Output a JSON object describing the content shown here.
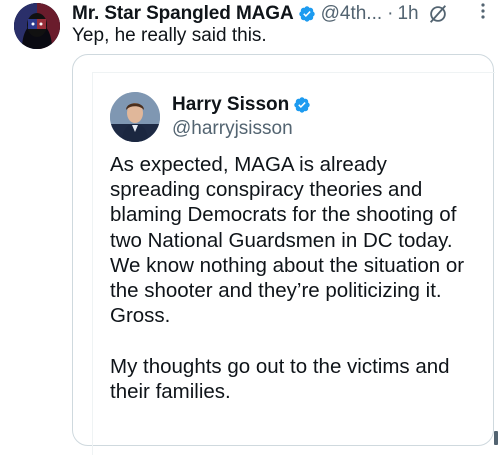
{
  "post": {
    "author_name": "Mr. Star Spangled MAGA",
    "author_handle": "@4th...",
    "separator": "·",
    "time": "1h",
    "text": "Yep, he really said this."
  },
  "quoted": {
    "author_name": "Harry Sisson",
    "author_handle": "@harryjsisson",
    "text": "As expected, MAGA is already spreading conspiracy theories and blaming Democrats for the shooting of two National Guardsmen in DC today. We know nothing about the situation or the shooter and they’re politicizing it. Gross.\n\nMy thoughts go out to the victims and their families."
  },
  "icons": {
    "verified": "verified-badge-icon",
    "grok": "grok-icon",
    "more": "more-options-icon"
  },
  "colors": {
    "verified_blue": "#1d9bf0",
    "secondary_text": "#536471",
    "border": "#cfd9de"
  }
}
